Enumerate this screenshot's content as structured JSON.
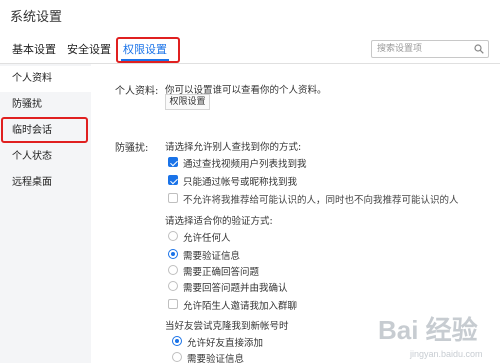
{
  "window": {
    "title": "系统设置"
  },
  "tabs": [
    {
      "label": "基本设置"
    },
    {
      "label": "安全设置"
    },
    {
      "label": "权限设置"
    }
  ],
  "search": {
    "placeholder": "搜索设置项"
  },
  "sidebar": {
    "items": [
      {
        "label": "个人资料"
      },
      {
        "label": "防骚扰"
      },
      {
        "label": "临时会话"
      },
      {
        "label": "个人状态"
      },
      {
        "label": "远程桌面"
      }
    ],
    "selected": "个人资料"
  },
  "profile": {
    "label": "个人资料:",
    "desc": "你可以设置谁可以查看你的个人资料。",
    "button": "权限设置"
  },
  "anti_harass": {
    "label": "防骚扰:",
    "find_title": "请选择允许别人查找到你的方式:",
    "find_options": [
      {
        "label": "通过查找视频用户列表找到我",
        "checked": true
      },
      {
        "label": "只能通过帐号或昵称找到我",
        "checked": true
      },
      {
        "label": "不允许将我推荐给可能认识的人，同时也不向我推荐可能认识的人",
        "checked": false
      }
    ],
    "verify_title": "请选择适合你的验证方式:",
    "verify_options": [
      {
        "label": "允许任何人",
        "selected": false
      },
      {
        "label": "需要验证信息",
        "selected": true
      },
      {
        "label": "需要正确回答问题",
        "selected": false
      },
      {
        "label": "需要回答问题并由我确认",
        "selected": false
      }
    ],
    "stranger_option": {
      "label": "允许陌生人邀请我加入群聊",
      "checked": false
    },
    "new_account_title": "当好友尝试克隆我到新帐号时",
    "new_account_options": [
      {
        "label": "允许好友直接添加",
        "selected": true
      },
      {
        "label": "需要验证信息",
        "selected": false
      }
    ]
  },
  "watermark": {
    "text": "Bai 经验",
    "sub": "jingyan.baidu.com"
  },
  "colors": {
    "accent": "#1a73e8",
    "highlight": "#e02020",
    "sidebar_bg": "#f4f5f7"
  }
}
